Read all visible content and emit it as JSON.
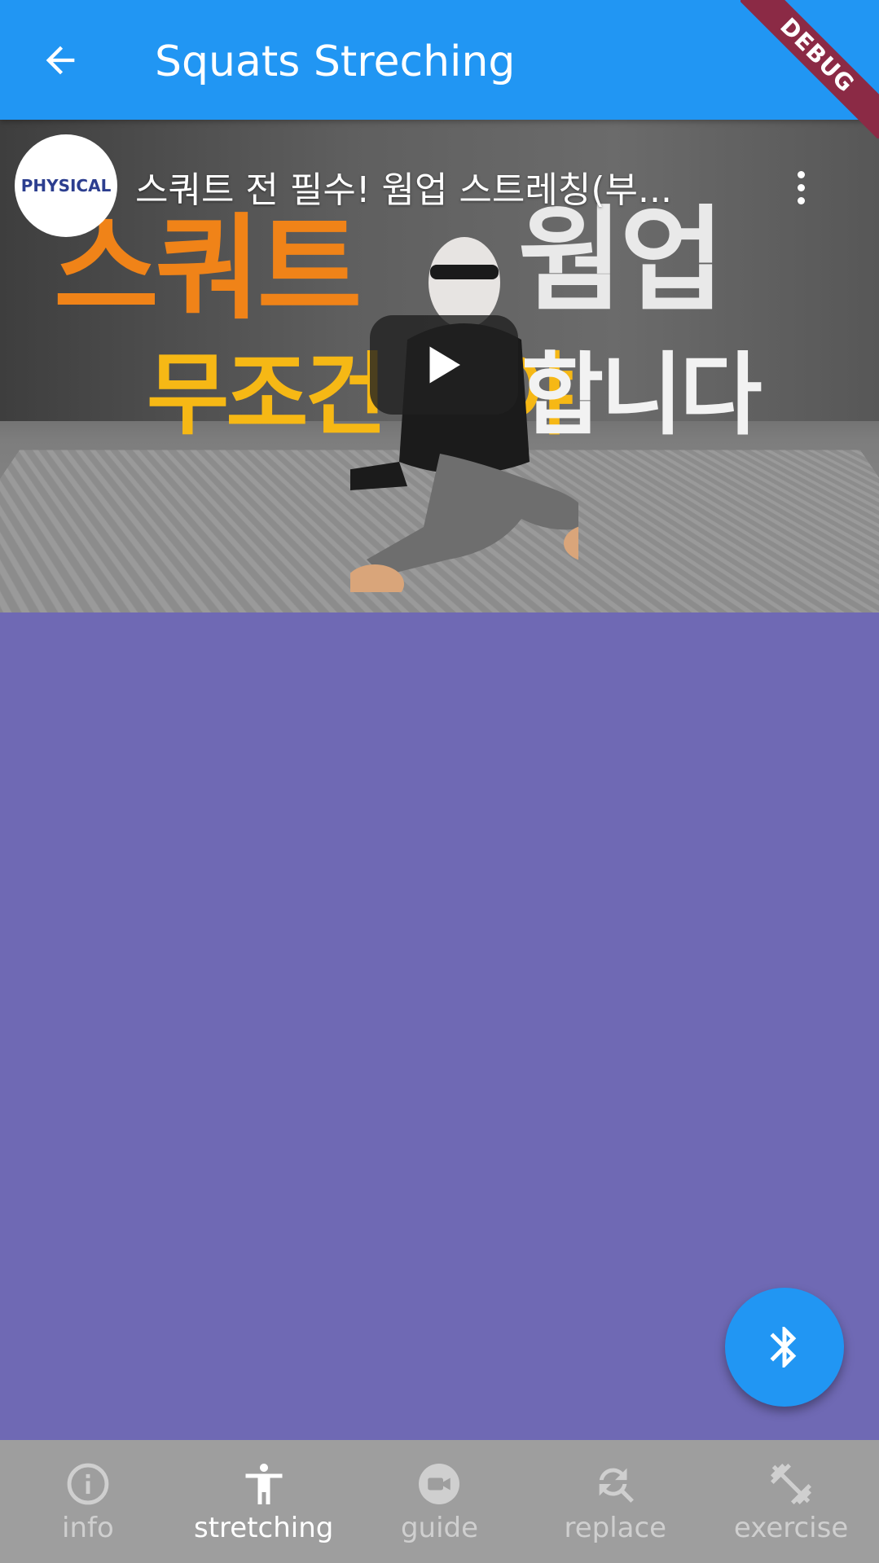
{
  "appbar": {
    "title": "Squats Streching",
    "debug_label": "DEBUG",
    "background": "#2196f3"
  },
  "video": {
    "channel_logo_text": "PHYSICAL",
    "title": "스쿼트 전 필수! 웜업 스트레칭(부...",
    "thumbnail_captions": [
      "스쿼트",
      "웜업",
      "무조건 해야",
      "합니다"
    ]
  },
  "fab": {
    "icon": "bluetooth-icon",
    "color": "#2196f3"
  },
  "bottom_nav": {
    "items": [
      {
        "label": "info",
        "icon": "info-icon",
        "active": false
      },
      {
        "label": "stretching",
        "icon": "accessibility-icon",
        "active": true
      },
      {
        "label": "guide",
        "icon": "video-camera-icon",
        "active": false
      },
      {
        "label": "replace",
        "icon": "find-replace-icon",
        "active": false
      },
      {
        "label": "exercise",
        "icon": "dumbbell-icon",
        "active": false
      }
    ]
  },
  "colors": {
    "body_background": "#6f69b4",
    "nav_background": "#9e9e9e",
    "debug_banner": "#8b2a45"
  }
}
